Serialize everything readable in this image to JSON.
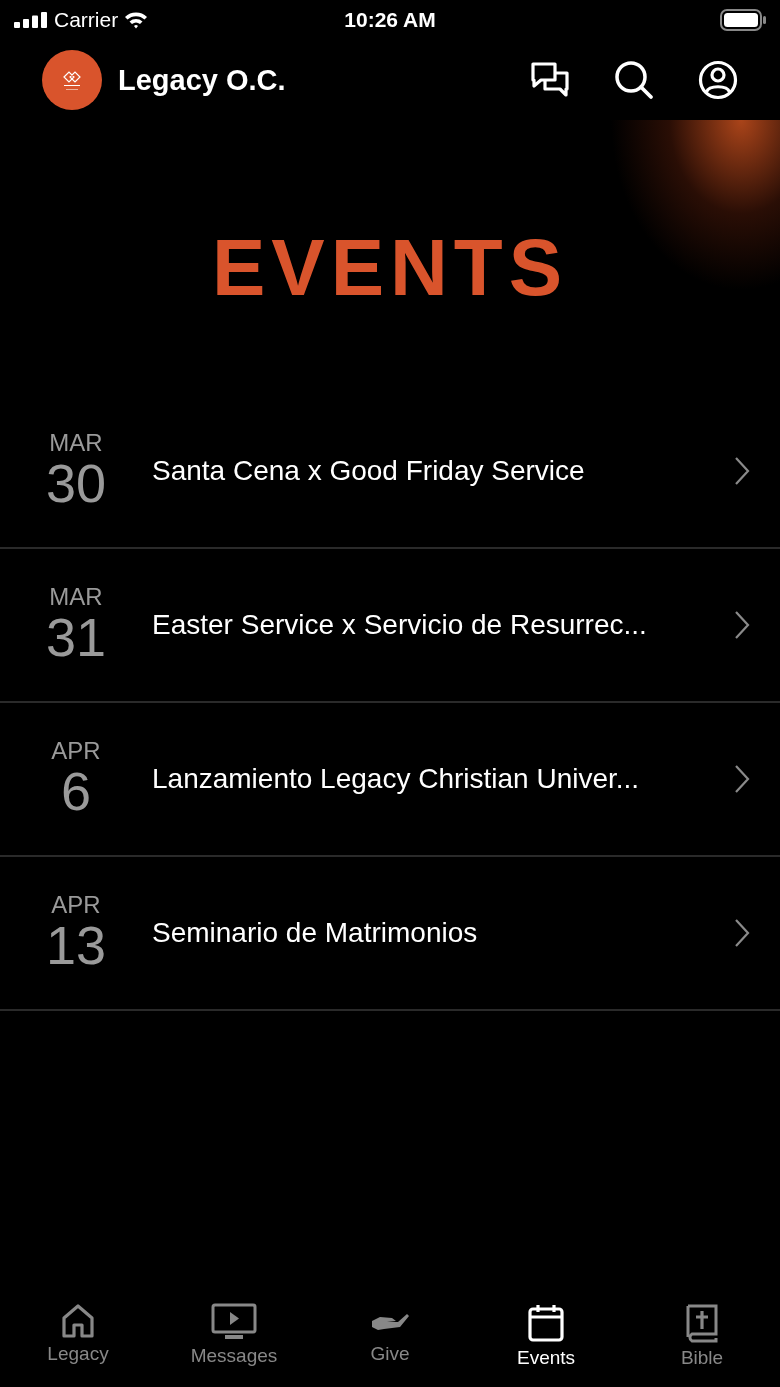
{
  "status_bar": {
    "carrier": "Carrier",
    "time": "10:26 AM"
  },
  "header": {
    "title": "Legacy O.C."
  },
  "banner": {
    "title": "EVENTS"
  },
  "events": [
    {
      "month": "MAR",
      "day": "30",
      "title": "Santa Cena x Good Friday Service"
    },
    {
      "month": "MAR",
      "day": "31",
      "title": "Easter Service x Servicio de Resurrec..."
    },
    {
      "month": "APR",
      "day": "6",
      "title": "Lanzamiento Legacy Christian Univer..."
    },
    {
      "month": "APR",
      "day": "13",
      "title": "Seminario de Matrimonios"
    }
  ],
  "tab_bar": [
    {
      "kind": "home",
      "label": "Legacy",
      "selected": false
    },
    {
      "kind": "tv",
      "label": "Messages",
      "selected": false
    },
    {
      "kind": "hand",
      "label": "Give",
      "selected": false
    },
    {
      "kind": "calendar",
      "label": "Events",
      "selected": true
    },
    {
      "kind": "book",
      "label": "Bible",
      "selected": false
    }
  ]
}
